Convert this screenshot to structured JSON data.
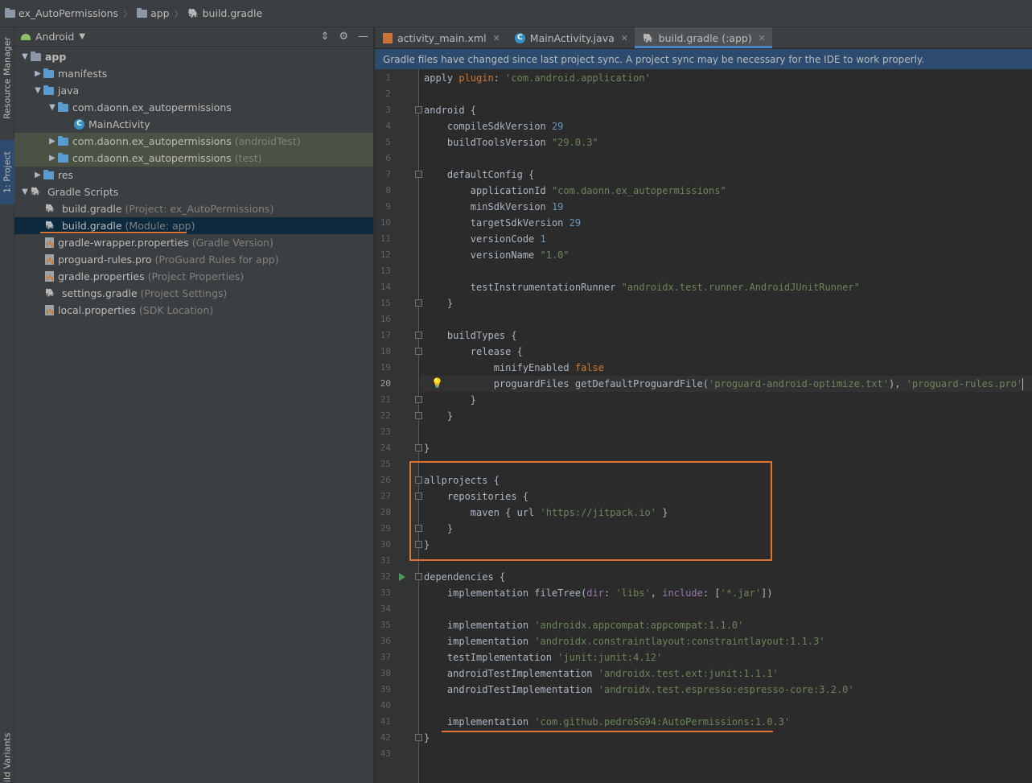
{
  "breadcrumb": {
    "project": "ex_AutoPermissions",
    "module": "app",
    "file": "build.gradle"
  },
  "side_tabs": {
    "resource_manager": "Resource Manager",
    "project": "1: Project",
    "build_variants": "ild Variants"
  },
  "project_panel": {
    "view_label": "Android",
    "tree": [
      {
        "label": "app",
        "sub": "",
        "icon": "module-folder-icon"
      },
      {
        "label": "manifests",
        "sub": "",
        "icon": "folder-icon"
      },
      {
        "label": "java",
        "sub": "",
        "icon": "folder-icon"
      },
      {
        "label": "com.daonn.ex_autopermissions",
        "sub": "",
        "icon": "package-icon"
      },
      {
        "label": "MainActivity",
        "sub": "",
        "icon": "class-icon"
      },
      {
        "label": "com.daonn.ex_autopermissions",
        "sub": "(androidTest)",
        "icon": "package-icon"
      },
      {
        "label": "com.daonn.ex_autopermissions",
        "sub": "(test)",
        "icon": "package-icon"
      },
      {
        "label": "res",
        "sub": "",
        "icon": "folder-icon"
      },
      {
        "label": "Gradle Scripts",
        "sub": "",
        "icon": "gradle-icon"
      },
      {
        "label": "build.gradle",
        "sub": "(Project: ex_AutoPermissions)",
        "icon": "gradle-icon"
      },
      {
        "label": "build.gradle",
        "sub": "(Module: app)",
        "icon": "gradle-icon"
      },
      {
        "label": "gradle-wrapper.properties",
        "sub": "(Gradle Version)",
        "icon": "properties-file-icon"
      },
      {
        "label": "proguard-rules.pro",
        "sub": "(ProGuard Rules for app)",
        "icon": "properties-file-icon"
      },
      {
        "label": "gradle.properties",
        "sub": "(Project Properties)",
        "icon": "properties-file-icon"
      },
      {
        "label": "settings.gradle",
        "sub": "(Project Settings)",
        "icon": "gradle-icon"
      },
      {
        "label": "local.properties",
        "sub": "(SDK Location)",
        "icon": "properties-file-icon"
      }
    ]
  },
  "tabs": [
    {
      "label": "activity_main.xml",
      "icon": "xml-file-icon"
    },
    {
      "label": "MainActivity.java",
      "icon": "java-class-icon"
    },
    {
      "label": "build.gradle (:app)",
      "icon": "gradle-icon"
    }
  ],
  "notification": "Gradle files have changed since last project sync. A project sync may be necessary for the IDE to work properly.",
  "editor": {
    "current_line": 20,
    "lines": [
      [
        [
          "k",
          "apply "
        ],
        [
          "kw",
          "plugin"
        ],
        [
          "k",
          ": "
        ],
        [
          "s",
          "'com.android.application'"
        ]
      ],
      [],
      [
        [
          "k",
          "android {"
        ]
      ],
      [
        [
          "k",
          "    compileSdkVersion "
        ],
        [
          "n",
          "29"
        ]
      ],
      [
        [
          "k",
          "    buildToolsVersion "
        ],
        [
          "s",
          "\"29.0.3\""
        ]
      ],
      [],
      [
        [
          "k",
          "    defaultConfig {"
        ]
      ],
      [
        [
          "k",
          "        applicationId "
        ],
        [
          "s",
          "\"com.daonn.ex_autopermissions\""
        ]
      ],
      [
        [
          "k",
          "        minSdkVersion "
        ],
        [
          "n",
          "19"
        ]
      ],
      [
        [
          "k",
          "        targetSdkVersion "
        ],
        [
          "n",
          "29"
        ]
      ],
      [
        [
          "k",
          "        versionCode "
        ],
        [
          "n",
          "1"
        ]
      ],
      [
        [
          "k",
          "        versionName "
        ],
        [
          "s",
          "\"1.0\""
        ]
      ],
      [],
      [
        [
          "k",
          "        testInstrumentationRunner "
        ],
        [
          "s",
          "\"androidx.test.runner.AndroidJUnitRunner\""
        ]
      ],
      [
        [
          "k",
          "    }"
        ]
      ],
      [],
      [
        [
          "k",
          "    buildTypes {"
        ]
      ],
      [
        [
          "k",
          "        release {"
        ]
      ],
      [
        [
          "k",
          "            minifyEnabled "
        ],
        [
          "kw",
          "false"
        ]
      ],
      [
        [
          "k",
          "            proguardFiles getDefaultProguardFile("
        ],
        [
          "s",
          "'proguard-android-optimize.txt'"
        ],
        [
          "k",
          "), "
        ],
        [
          "s",
          "'proguard-rules.pro'"
        ]
      ],
      [
        [
          "k",
          "        }"
        ]
      ],
      [
        [
          "k",
          "    }"
        ]
      ],
      [],
      [
        [
          "k",
          "}"
        ]
      ],
      [],
      [
        [
          "k",
          "allprojects {"
        ]
      ],
      [
        [
          "k",
          "    repositories {"
        ]
      ],
      [
        [
          "k",
          "        maven { url "
        ],
        [
          "s",
          "'https://jitpack.io'"
        ],
        [
          "k",
          " }"
        ]
      ],
      [
        [
          "k",
          "    }"
        ]
      ],
      [
        [
          "k",
          "}"
        ]
      ],
      [],
      [
        [
          "k",
          "dependencies {"
        ]
      ],
      [
        [
          "k",
          "    implementation fileTree("
        ],
        [
          "id",
          "dir"
        ],
        [
          "k",
          ": "
        ],
        [
          "s",
          "'libs'"
        ],
        [
          "k",
          ", "
        ],
        [
          "id",
          "include"
        ],
        [
          "k",
          ": ["
        ],
        [
          "s",
          "'*.jar'"
        ],
        [
          "k",
          "])"
        ]
      ],
      [],
      [
        [
          "k",
          "    implementation "
        ],
        [
          "s",
          "'androidx.appcompat:appcompat:1.1.0'"
        ]
      ],
      [
        [
          "k",
          "    implementation "
        ],
        [
          "s",
          "'androidx.constraintlayout:constraintlayout:1.1.3'"
        ]
      ],
      [
        [
          "k",
          "    testImplementation "
        ],
        [
          "s",
          "'junit:junit:4.12'"
        ]
      ],
      [
        [
          "k",
          "    androidTestImplementation "
        ],
        [
          "s",
          "'androidx.test.ext:junit:1.1.1'"
        ]
      ],
      [
        [
          "k",
          "    androidTestImplementation "
        ],
        [
          "s",
          "'androidx.test.espresso:espresso-core:3.2.0'"
        ]
      ],
      [],
      [
        [
          "k",
          "    implementation "
        ],
        [
          "s",
          "'com.github.pedroSG94:AutoPermissions:1.0.3'"
        ]
      ],
      [
        [
          "k",
          "}"
        ]
      ],
      []
    ]
  }
}
